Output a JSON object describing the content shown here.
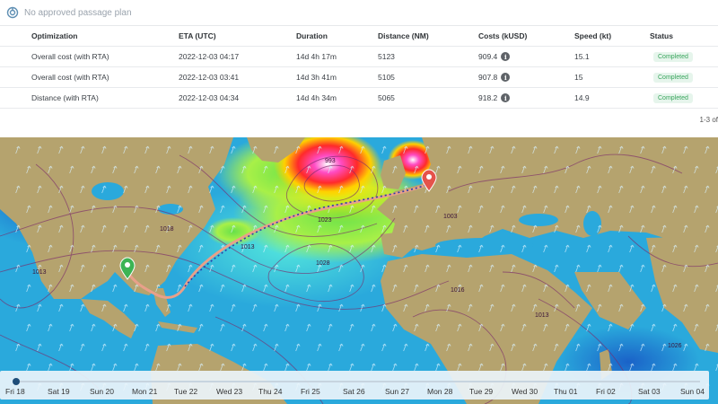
{
  "plan": {
    "label": "No approved passage plan"
  },
  "table": {
    "headers": [
      "Optimization",
      "ETA (UTC)",
      "Duration",
      "Distance (NM)",
      "Costs (kUSD)",
      "Speed (kt)",
      "Status"
    ],
    "rows": [
      {
        "optimization": "Overall cost (with RTA)",
        "eta": "2022-12-03 04:17",
        "duration": "14d 4h 17m",
        "distance": "5123",
        "cost": "909.4",
        "speed": "15.1",
        "status": "Completed"
      },
      {
        "optimization": "Overall cost (with RTA)",
        "eta": "2022-12-03 03:41",
        "duration": "14d 3h 41m",
        "distance": "5105",
        "cost": "907.8",
        "speed": "15",
        "status": "Completed"
      },
      {
        "optimization": "Distance (with RTA)",
        "eta": "2022-12-03 04:34",
        "duration": "14d 4h 34m",
        "distance": "5065",
        "cost": "918.2",
        "speed": "14.9",
        "status": "Completed"
      }
    ],
    "pagination": "1-3 of"
  },
  "map": {
    "isobars": [
      "993",
      "1023",
      "1028",
      "1013",
      "1018",
      "1003",
      "1013",
      "1016",
      "1013",
      "1026"
    ],
    "colors": {
      "ocean": "#2aa9dc",
      "land": "#b5a36e",
      "route": "#e8a08a",
      "start": "#3cb454",
      "end": "#e5534b"
    }
  },
  "timeline": {
    "days": [
      "Fri 18",
      "Sat 19",
      "Sun 20",
      "Mon 21",
      "Tue 22",
      "Wed 23",
      "Thu 24",
      "Fri 25",
      "Sat 26",
      "Sun 27",
      "Mon 28",
      "Tue 29",
      "Wed 30",
      "Thu 01",
      "Fri 02",
      "Sat 03",
      "Sun 04"
    ]
  }
}
